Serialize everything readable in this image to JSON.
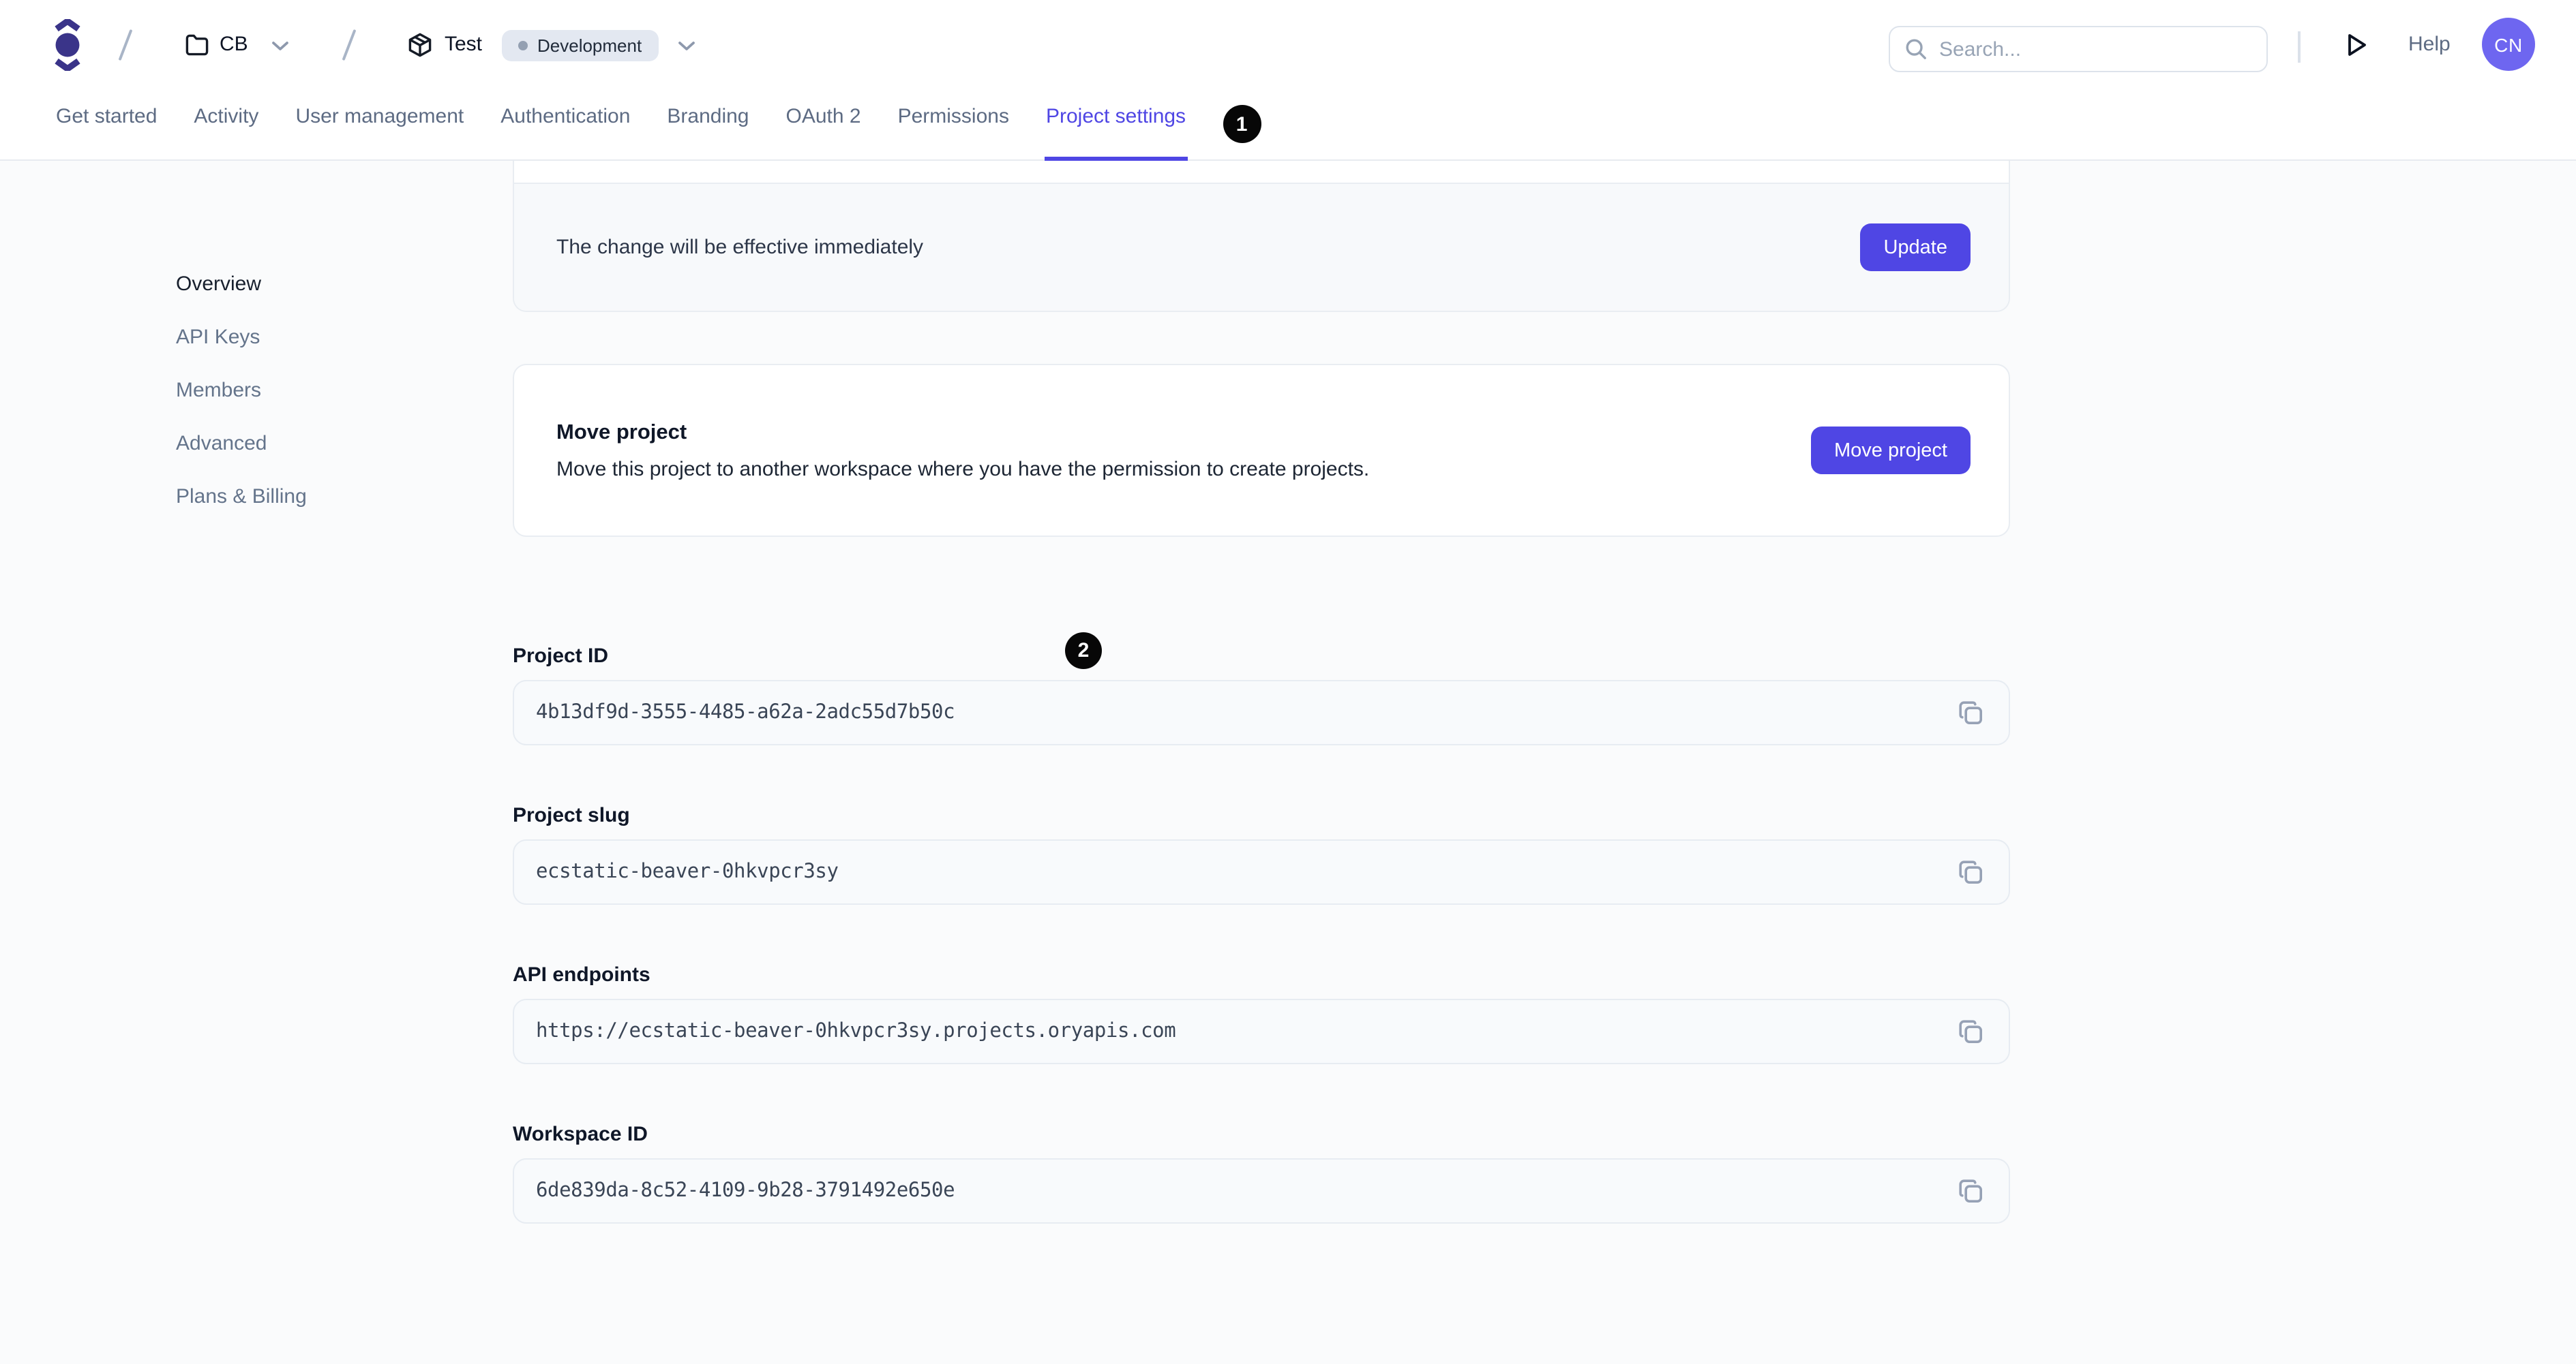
{
  "header": {
    "workspace_name": "CB",
    "project_name": "Test",
    "environment_badge": "Development",
    "search_placeholder": "Search...",
    "help_label": "Help",
    "avatar_initials": "CN"
  },
  "tabs": [
    {
      "label": "Get started",
      "active": false
    },
    {
      "label": "Activity",
      "active": false
    },
    {
      "label": "User management",
      "active": false
    },
    {
      "label": "Authentication",
      "active": false
    },
    {
      "label": "Branding",
      "active": false
    },
    {
      "label": "OAuth 2",
      "active": false
    },
    {
      "label": "Permissions",
      "active": false
    },
    {
      "label": "Project settings",
      "active": true
    }
  ],
  "sidebar": {
    "items": [
      {
        "label": "Overview",
        "active": true
      },
      {
        "label": "API Keys",
        "active": false
      },
      {
        "label": "Members",
        "active": false
      },
      {
        "label": "Advanced",
        "active": false
      },
      {
        "label": "Plans & Billing",
        "active": false
      }
    ]
  },
  "main": {
    "update_bar": {
      "message": "The change will be effective immediately",
      "button_label": "Update"
    },
    "move_card": {
      "title": "Move project",
      "description": "Move this project to another workspace where you have the permission to create projects.",
      "button_label": "Move project"
    },
    "fields": [
      {
        "label": "Project ID",
        "value": "4b13df9d-3555-4485-a62a-2adc55d7b50c"
      },
      {
        "label": "Project slug",
        "value": "ecstatic-beaver-0hkvpcr3sy"
      },
      {
        "label": "API endpoints",
        "value": "https://ecstatic-beaver-0hkvpcr3sy.projects.oryapis.com"
      },
      {
        "label": "Workspace ID",
        "value": "6de839da-8c52-4109-9b28-3791492e650e"
      }
    ]
  },
  "annotations": {
    "marker_1": "1",
    "marker_2": "2"
  },
  "colors": {
    "accent": "#4f46e4",
    "logo": "#3a3489",
    "avatar_bg": "#6e66f0",
    "page_bg": "#fafbfc",
    "card_border": "#e9edf2",
    "field_bg": "#f8fafc",
    "badge_bg": "#e3e8f1",
    "marker_bg": "#070707"
  }
}
